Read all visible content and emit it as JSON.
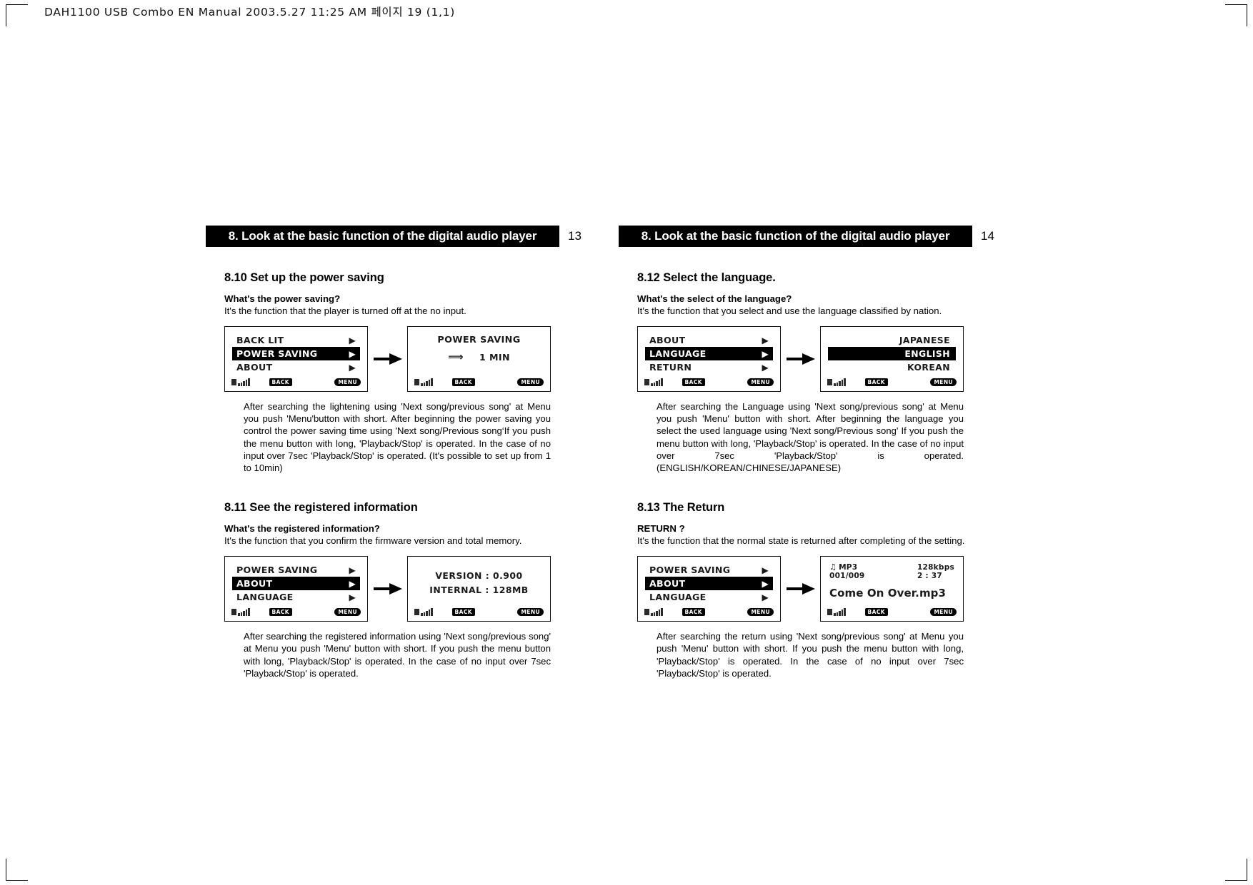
{
  "slug": "DAH1100 USB Combo EN Manual  2003.5.27 11:25 AM 페이지 19 (1,1)",
  "lcd_status": {
    "back_label": "BACK",
    "menu_label": "MENU"
  },
  "pages": [
    {
      "header": "8. Look at the basic function of the digital audio player",
      "page_number": "13",
      "sections": [
        {
          "title": "8.10 Set up the power saving",
          "question": "What's the power saving?",
          "answer": "It's the function that the player is turned off at the no input.",
          "screen1": {
            "type": "menu",
            "items": [
              {
                "label": "BACK LIT",
                "selected": false,
                "arrow": "▶"
              },
              {
                "label": "POWER SAVING",
                "selected": true,
                "arrow": "▶"
              },
              {
                "label": "ABOUT",
                "selected": false,
                "arrow": "▶"
              }
            ]
          },
          "screen2": {
            "type": "value",
            "title": "POWER SAVING",
            "arrow": "⟹",
            "value": "1 MIN"
          },
          "body": "After searching the lightening using 'Next song/previous song' at Menu you push 'Menu'button with short. After beginning the power saving you control the power saving time using 'Next song/Previous song‘If you push the menu button with long, 'Playback/Stop' is operated. In the case of no input over 7sec 'Playback/Stop' is operated. (It's possible to set up from 1 to 10min)"
        },
        {
          "title": "8.11 See the registered information",
          "question": "What's the registered information?",
          "answer": "It's the function that you confirm the firmware version and total memory.",
          "screen1": {
            "type": "menu",
            "items": [
              {
                "label": "POWER SAVING",
                "selected": false,
                "arrow": "▶"
              },
              {
                "label": "ABOUT",
                "selected": true,
                "arrow": "▶"
              },
              {
                "label": "LANGUAGE",
                "selected": false,
                "arrow": "▶"
              }
            ]
          },
          "screen2": {
            "type": "info",
            "line1": "VERSION : 0.900",
            "line2": "INTERNAL : 128MB"
          },
          "body": "After searching the registered information using 'Next song/previous song' at Menu you push 'Menu' button with short. If you push the menu button with long, 'Playback/Stop' is operated. In the case of no input over 7sec 'Playback/Stop' is operated."
        }
      ]
    },
    {
      "header": "8. Look at the basic function of the digital audio player",
      "page_number": "14",
      "sections": [
        {
          "title": "8.12 Select the language.",
          "question": "What's the select of the language?",
          "answer": "It's the function that you select and use the language classified by nation.",
          "screen1": {
            "type": "menu",
            "items": [
              {
                "label": "ABOUT",
                "selected": false,
                "arrow": "▶"
              },
              {
                "label": "LANGUAGE",
                "selected": true,
                "arrow": "▶"
              },
              {
                "label": "RETURN",
                "selected": false,
                "arrow": "▶"
              }
            ]
          },
          "screen2": {
            "type": "lang",
            "items": [
              {
                "label": "JAPANESE",
                "selected": false
              },
              {
                "label": "ENGLISH",
                "selected": true
              },
              {
                "label": "KOREAN",
                "selected": false
              }
            ]
          },
          "body": "After searching the Language using 'Next song/previous song' at Menu you push 'Menu' button with short. After beginning the language you select the used language using 'Next song/Previous song' If you push the menu button with long, 'Playback/Stop' is operated. In the case of no input over 7sec 'Playback/Stop' is operated. (ENGLISH/KOREAN/CHINESE/JAPANESE)"
        },
        {
          "title": "8.13 The Return",
          "question": "RETURN ?",
          "answer": "It's the function that the normal state is returned after completing of the setting.",
          "screen1": {
            "type": "menu",
            "items": [
              {
                "label": "POWER SAVING",
                "selected": false,
                "arrow": "▶"
              },
              {
                "label": "ABOUT",
                "selected": true,
                "arrow": "▶"
              },
              {
                "label": "LANGUAGE",
                "selected": false,
                "arrow": "▶"
              }
            ]
          },
          "screen2": {
            "type": "nowplaying",
            "note_icon": "♫",
            "format": "MP3",
            "bitrate": "128kbps",
            "track": "001/009",
            "time": "2 : 37",
            "title": "Come On Over.mp3"
          },
          "body": "After searching the return using 'Next song/previous song' at Menu you push 'Menu' button with short. If you push the menu button with long, 'Playback/Stop' is operated. In the case of no input over 7sec 'Playback/Stop' is operated."
        }
      ]
    }
  ]
}
